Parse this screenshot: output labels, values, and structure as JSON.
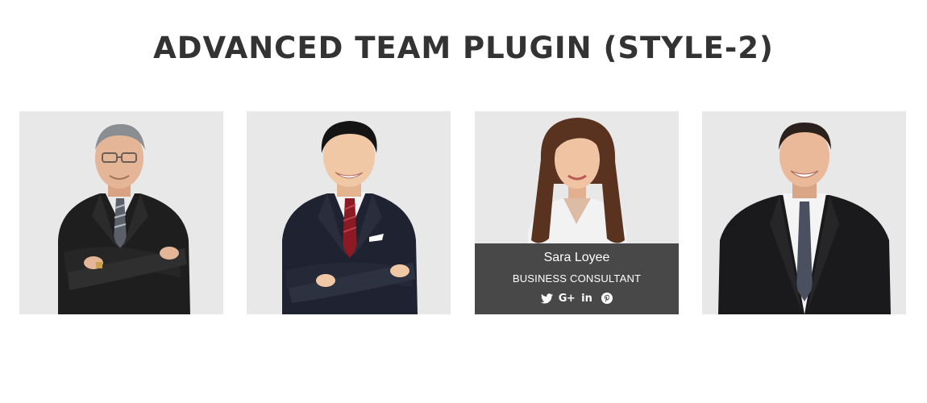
{
  "page": {
    "title": "ADVANCED TEAM PLUGIN (STYLE-2)"
  },
  "team": {
    "members": [
      {
        "name": "",
        "role": "",
        "image": "older-man-crossed-arms-photo"
      },
      {
        "name": "",
        "role": "",
        "image": "young-man-crossed-arms-photo"
      },
      {
        "name": "Sara Loyee",
        "role": "BUSINESS CONSULTANT",
        "image": "woman-portrait-photo",
        "social": {
          "twitter": "twitter-icon",
          "googleplus": "G+",
          "linkedin": "in",
          "pinterest": "pinterest-icon"
        }
      },
      {
        "name": "",
        "role": "",
        "image": "man-smiling-suit-photo"
      }
    ]
  },
  "colors": {
    "title": "#333333",
    "card_background": "#e8e8e8",
    "overlay": "#3a3a3a",
    "overlay_text": "#ffffff"
  }
}
